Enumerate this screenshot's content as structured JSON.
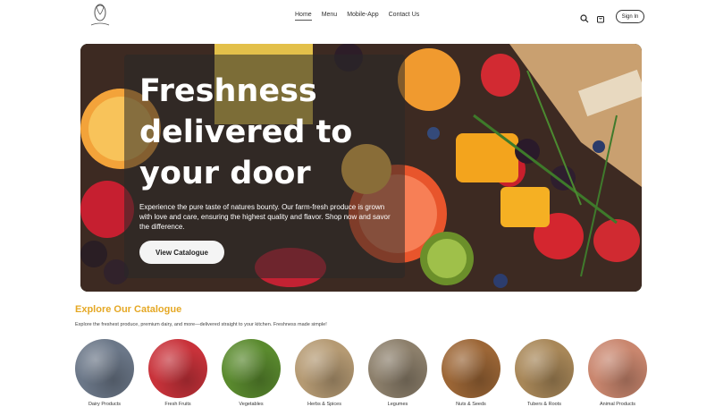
{
  "header": {
    "nav": [
      "Home",
      "Menu",
      "Mobile-App",
      "Contact Us"
    ],
    "signin_label": "Sign In",
    "icons": [
      "search-icon",
      "cart-icon"
    ]
  },
  "hero": {
    "title": "Freshness delivered to your door",
    "description": "Experience the pure taste of natures bounty. Our farm-fresh produce is grown with love and care, ensuring the highest quality and flavor. Shop now and savor the difference.",
    "button_label": "View Catalogue"
  },
  "catalogue": {
    "title": "Explore Our Catalogue",
    "description": "Explore the freshest produce, premium dairy, and more—delivered straight to your kitchen. Freshness made simple!",
    "items": [
      {
        "label": "Dairy Products",
        "color": "#6b7788"
      },
      {
        "label": "Fresh Fruits",
        "color": "#c8323a"
      },
      {
        "label": "Vegetables",
        "color": "#5a8a2e"
      },
      {
        "label": "Herbs & Spices",
        "color": "#b59a73"
      },
      {
        "label": "Legumes",
        "color": "#8c7f6b"
      },
      {
        "label": "Nuts & Seeds",
        "color": "#9c6636"
      },
      {
        "label": "Tubers & Roots",
        "color": "#a88758"
      },
      {
        "label": "Animal Products",
        "color": "#c9866e"
      }
    ]
  },
  "colors": {
    "accent": "#e5a825",
    "overlay": "#282828"
  }
}
